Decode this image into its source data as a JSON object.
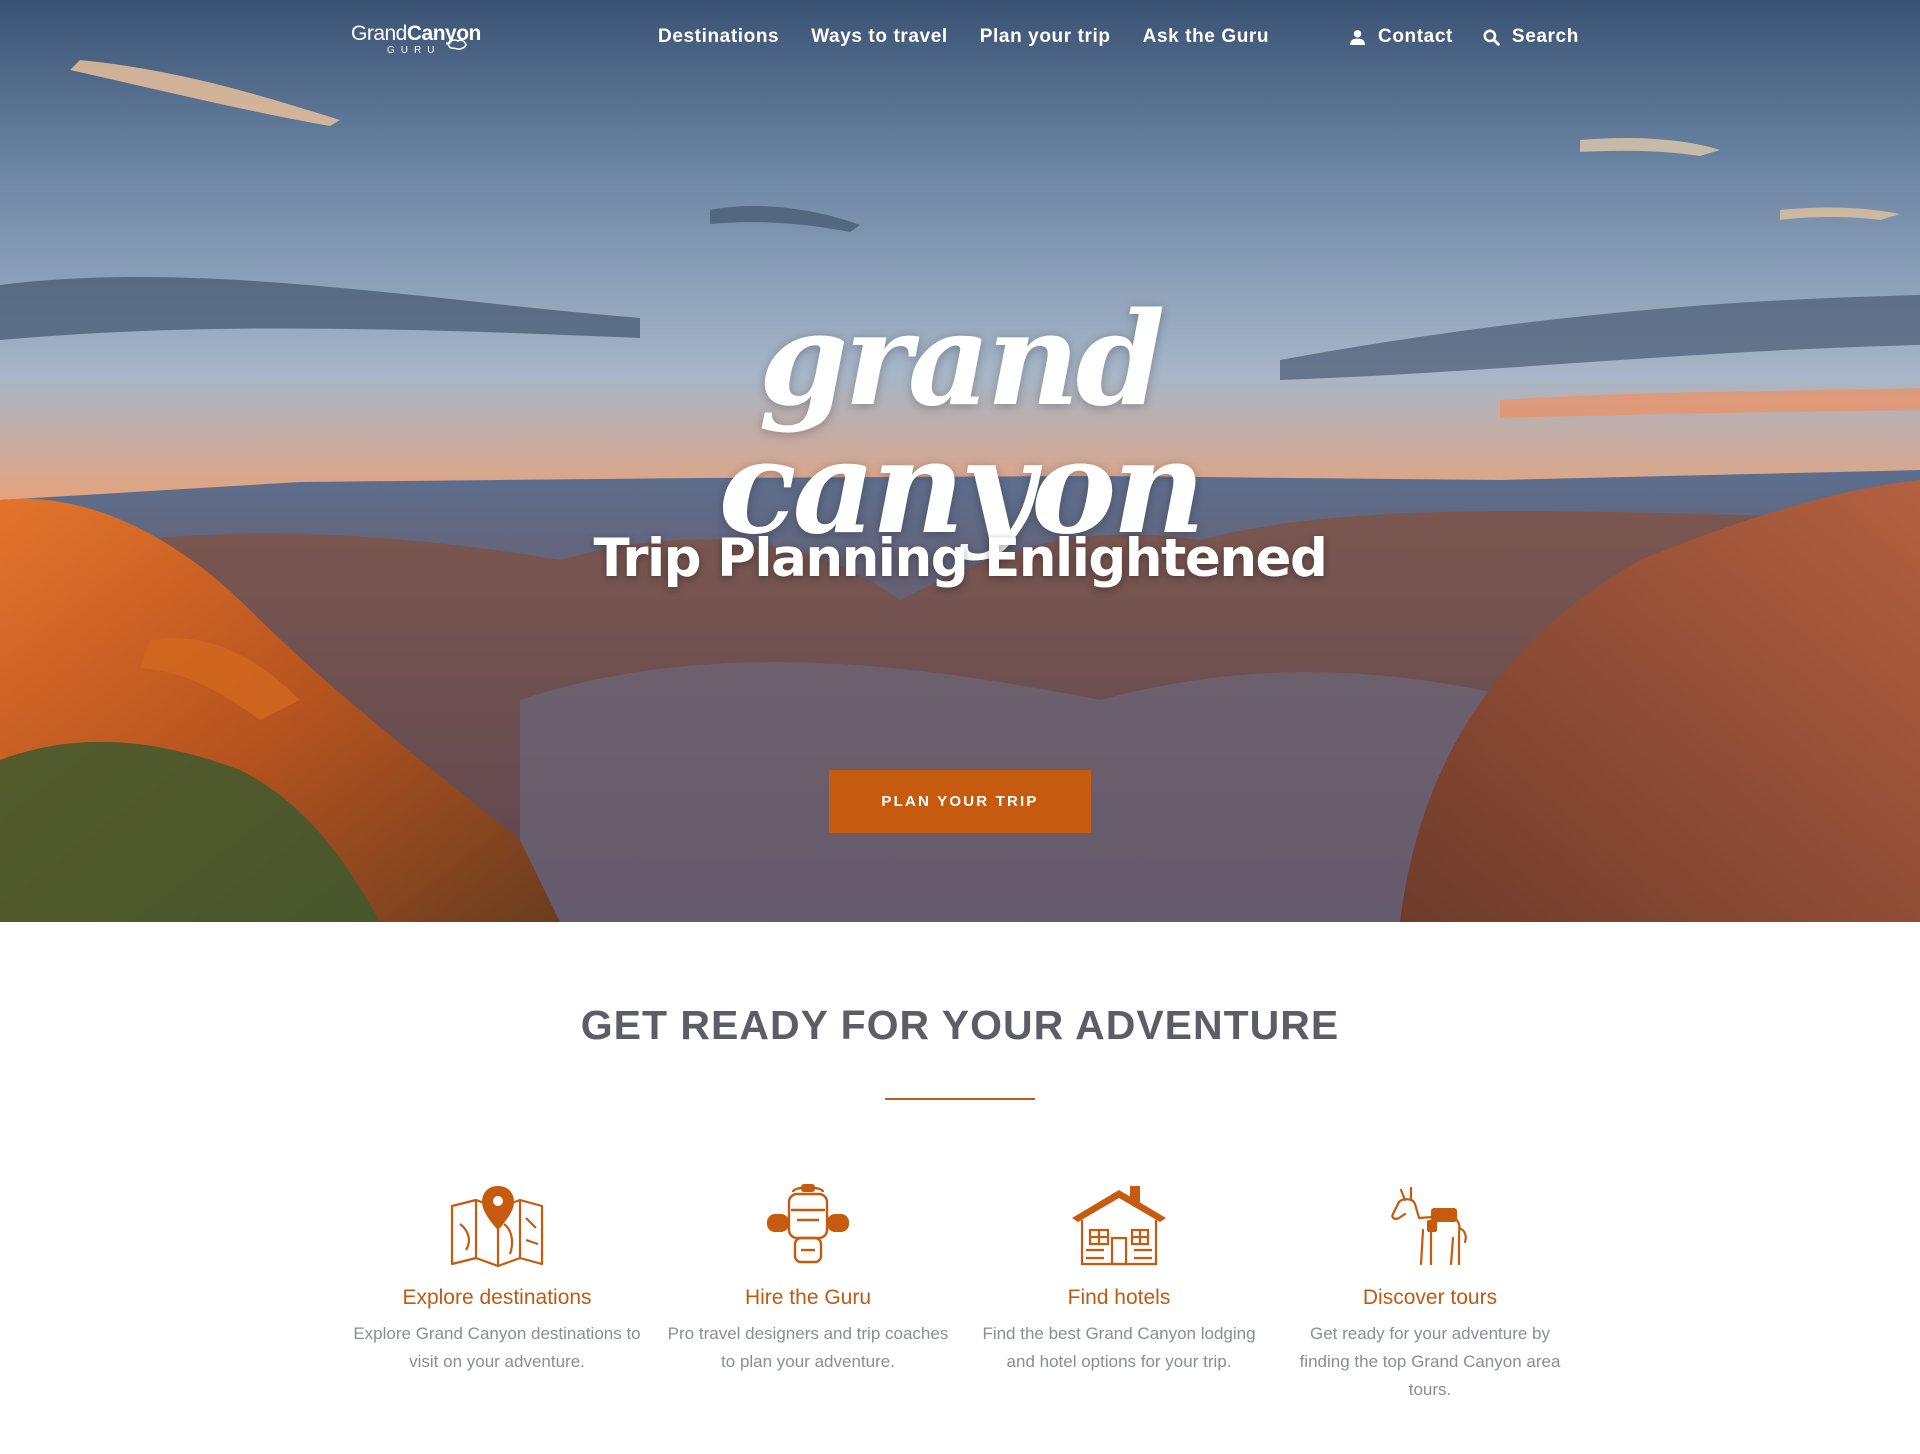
{
  "logo": {
    "text_a": "Grand",
    "text_b": "Canyon",
    "tagline": "GURU"
  },
  "nav": {
    "items": [
      {
        "label": "Destinations"
      },
      {
        "label": "Ways to travel"
      },
      {
        "label": "Plan your trip"
      },
      {
        "label": "Ask the Guru"
      }
    ],
    "contact_label": "Contact",
    "search_label": "Search"
  },
  "hero": {
    "title": "grand canyon",
    "subtitle": "Trip Planning Enlightened",
    "cta_label": "PLAN YOUR TRIP"
  },
  "section": {
    "title": "GET READY FOR YOUR ADVENTURE"
  },
  "features": [
    {
      "title": "Explore destinations",
      "desc": "Explore Grand Canyon destinations to visit on your adventure.",
      "icon": "map-pin-icon"
    },
    {
      "title": "Hire the Guru",
      "desc": "Pro travel designers and trip coaches to plan your adventure.",
      "icon": "backpack-icon"
    },
    {
      "title": "Find hotels",
      "desc": "Find the best Grand Canyon lodging and hotel options for your trip.",
      "icon": "cabin-icon"
    },
    {
      "title": "Discover tours",
      "desc": "Get ready for your adventure by finding the top Grand Canyon area tours.",
      "icon": "mule-icon"
    }
  ],
  "colors": {
    "accent": "#c65a0f",
    "heading": "#5b5e66",
    "body_text": "#8a8d94",
    "feature_title": "#bf5a12"
  }
}
